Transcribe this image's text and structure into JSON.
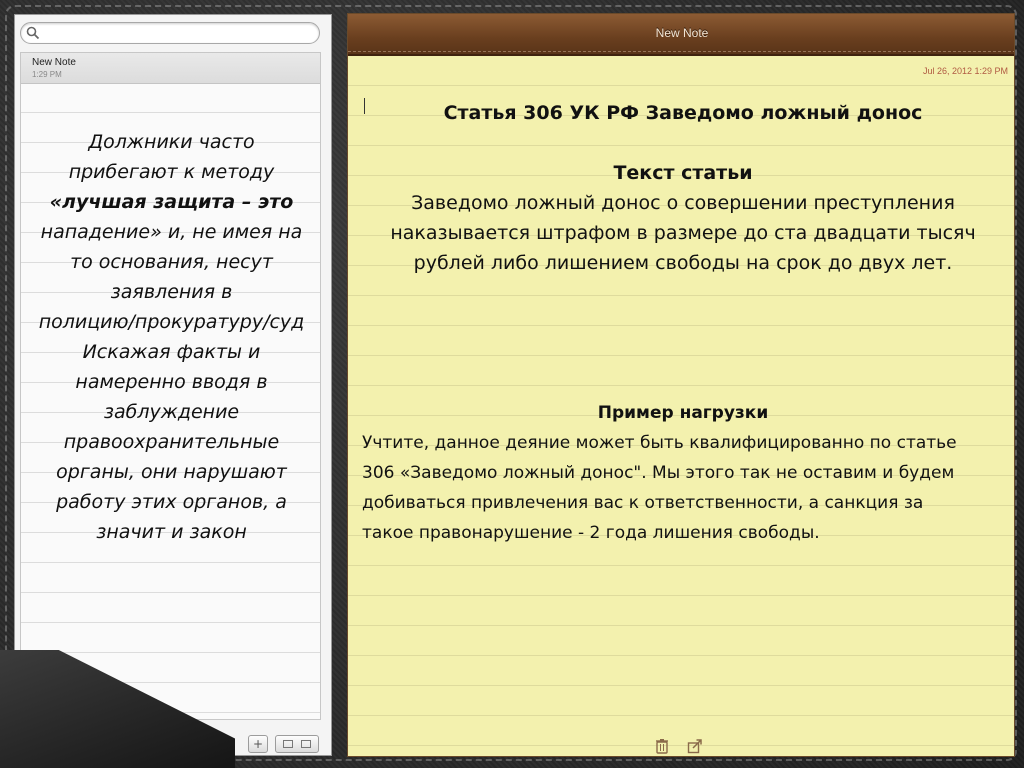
{
  "search": {
    "placeholder": ""
  },
  "sidebar": {
    "note_title": "New Note",
    "note_time": "1:29 PM",
    "text_lines": [
      "Должники часто",
      "прибегают к методу",
      "«лучшая защита – это",
      "нападение» и, не имея на",
      "то основания, несут",
      "заявления в",
      "полицию/прокуратуру/суд",
      "Искажая факты и",
      "намеренно вводя в",
      "заблуждение",
      "правоохранительные",
      "органы, они нарушают",
      "работу этих органов, а",
      "значит и закон"
    ],
    "add_label": "+"
  },
  "note": {
    "header_title": "New Note",
    "date": "Jul 26, 2012 1:29 PM",
    "heading": "Статья 306 УК РФ Заведомо ложный донос",
    "subheading": "Текст статьи",
    "article_lines": [
      "Заведомо ложный донос о совершении преступления",
      "наказывается штрафом в размере до ста двадцати тысяч",
      "рублей  либо лишением свободы на срок до двух лет."
    ],
    "example_heading": "Пример нагрузки",
    "example_lines": [
      "Учтите, данное деяние может быть квалифицированно по статье",
      "306 «Заведомо ложный донос\". Мы этого так не оставим и будем",
      "добиваться привлечения вас к ответственности, а санкция за",
      "такое правонарушение - 2 года лишения свободы."
    ]
  },
  "icons": {
    "search": "search-icon",
    "trash": "trash-icon",
    "share": "share-icon",
    "view_toggle": "view-toggle-icon"
  },
  "colors": {
    "header_brown": "#6a3f1f",
    "paper_yellow": "#f3f1ae",
    "date_red": "#b05a42"
  }
}
